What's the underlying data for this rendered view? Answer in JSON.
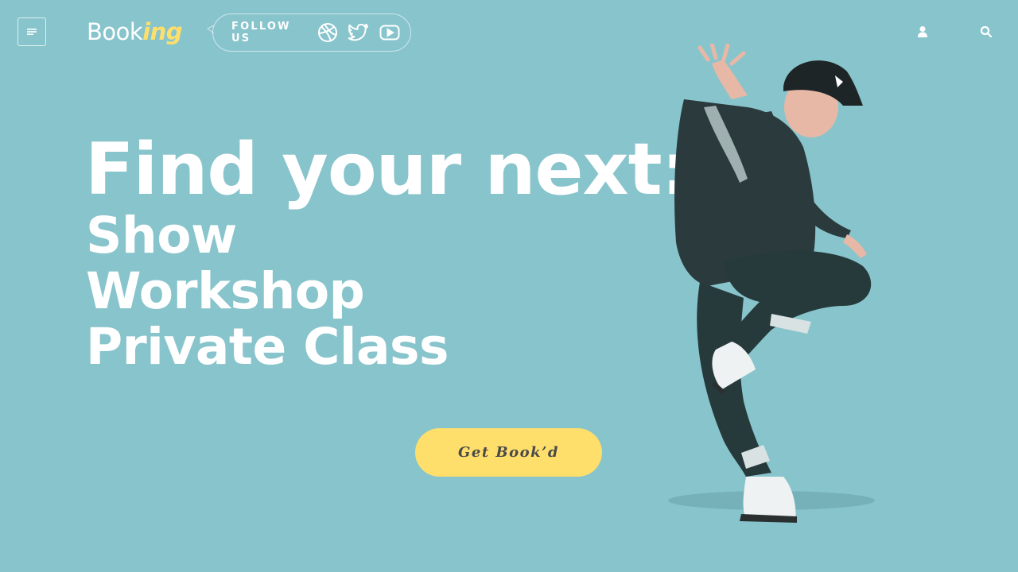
{
  "header": {
    "logo": {
      "plain": "Book",
      "accent": "ing"
    },
    "follow": {
      "label": "FOLLOW US",
      "icons": [
        "dribbble-icon",
        "twitter-icon",
        "youtube-icon"
      ]
    },
    "icons": {
      "menu": "menu-icon",
      "user": "user-icon",
      "search": "search-icon"
    }
  },
  "hero": {
    "headline": "Find your next:",
    "options": [
      "Show",
      "Workshop",
      "Private Class"
    ],
    "cta_label": "Get Book’d"
  },
  "colors": {
    "background": "#88c4cc",
    "accent": "#ffdf6b",
    "text": "#ffffff",
    "button_text": "#4a4a4a"
  }
}
